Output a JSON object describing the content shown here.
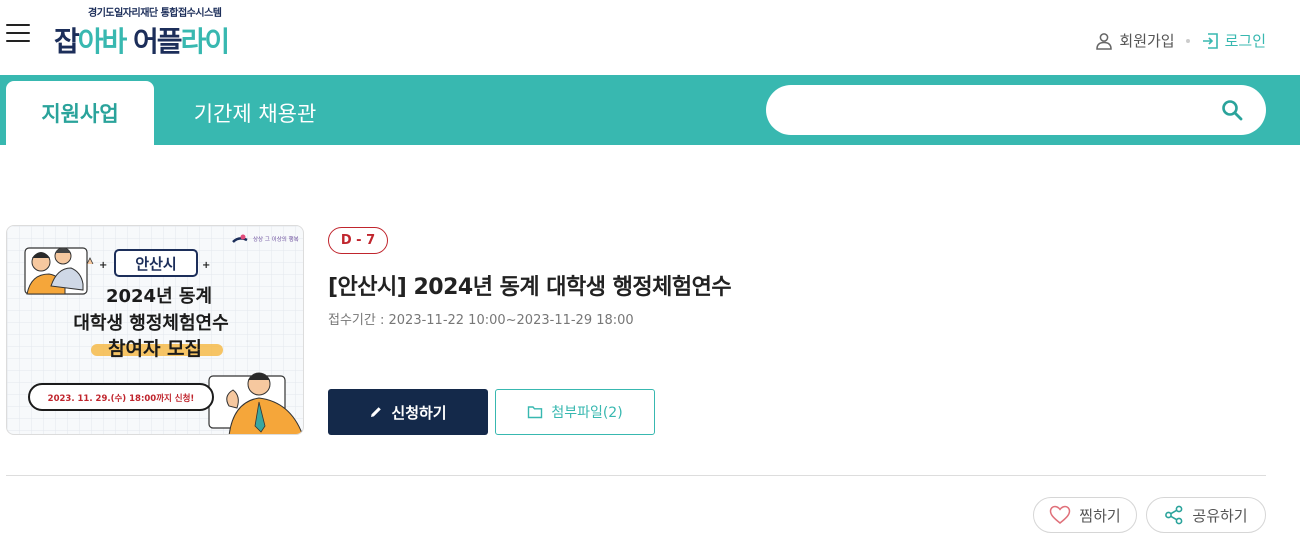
{
  "header": {
    "logo_subtitle": "경기도일자리재단 통합접수시스템",
    "logo_parts": [
      "잡",
      "아바",
      " 어플",
      "라이"
    ],
    "join_label": "회원가입",
    "login_label": "로그인"
  },
  "nav": {
    "tabs": [
      {
        "label": "지원사업",
        "active": true
      },
      {
        "label": "기간제 채용관",
        "active": false
      }
    ],
    "search_placeholder": ""
  },
  "program": {
    "dday": "D - 7",
    "title": "[안산시] 2024년 동계 대학생 행정체험연수",
    "period_label": "접수기간 :",
    "period_value": "2023-11-22 10:00~2023-11-29 18:00",
    "apply_label": "신청하기",
    "attachment_label": "첨부파일(2)"
  },
  "poster": {
    "city_badge": "안산시",
    "line1": "2024년 동계",
    "line2": "대학생 행정체험연수",
    "line3": "참여자 모집",
    "deadline": "2023. 11. 29.(수) 18:00까지 신청!",
    "slogan": "상상 그 이상의 행복"
  },
  "actions": {
    "like_label": "찜하기",
    "share_label": "공유하기"
  },
  "colors": {
    "teal": "#38b8b0",
    "navy": "#14294a",
    "dday_red": "#c0252d"
  },
  "icons": [
    "hamburger-icon",
    "user-icon",
    "login-icon",
    "search-icon",
    "pencil-icon",
    "folder-icon",
    "heart-icon",
    "share-icon"
  ]
}
